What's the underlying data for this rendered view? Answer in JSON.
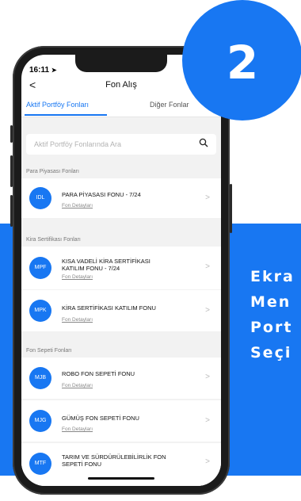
{
  "side_text": {
    "line1": "Ekra",
    "line2": "Men",
    "line3": "Port",
    "line4": "Seçi"
  },
  "step_number": "2",
  "status_bar": {
    "time": "16:11",
    "location_icon": "location-arrow-icon"
  },
  "header": {
    "back_icon": "chevron-left-icon",
    "title": "Fon Alış"
  },
  "tabs": [
    {
      "label": "Aktif Portföy Fonları",
      "active": true
    },
    {
      "label": "Diğer Fonlar",
      "active": false
    }
  ],
  "search": {
    "placeholder": "Aktif Portföy Fonlarında Ara",
    "icon": "search-icon"
  },
  "sections": [
    {
      "title": "Para Piyasası Fonları",
      "funds": [
        {
          "code": "IDL",
          "name": "PARA PİYASASI FONU - 7/24",
          "link": "Fon Detayları"
        }
      ]
    },
    {
      "title": "Kira Sertifikası Fonları",
      "funds": [
        {
          "code": "MPF",
          "name": "KISA VADELİ KİRA SERTİFİKASI KATILIM FONU - 7/24",
          "link": "Fon Detayları"
        },
        {
          "code": "MPK",
          "name": "KİRA SERTİFİKASI KATILIM FONU",
          "link": "Fon Detayları"
        }
      ]
    },
    {
      "title": "Fon Sepeti Fonları",
      "funds": [
        {
          "code": "MJB",
          "name": "ROBO FON SEPETİ FONU",
          "link": "Fon Detayları"
        },
        {
          "code": "MJG",
          "name": "GÜMÜŞ FON SEPETİ FONU",
          "link": "Fon Detayları"
        },
        {
          "code": "MTF",
          "name": "TARIM VE SÜRDÜRÜLEBİLİRLİK FON SEPETİ FONU",
          "link": ""
        }
      ]
    }
  ],
  "colors": {
    "accent": "#1877f2",
    "badge": "#1877f2",
    "background_band": "#1877f2"
  }
}
